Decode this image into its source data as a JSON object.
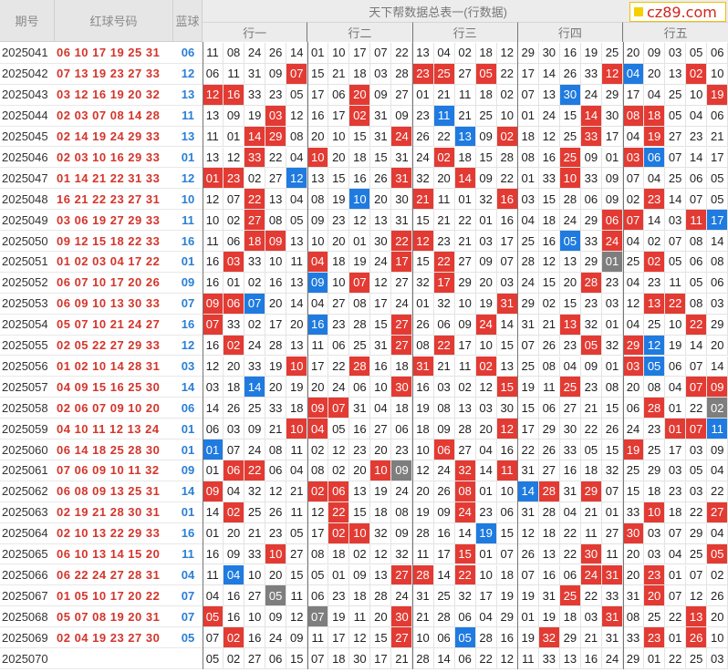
{
  "header": {
    "period_label": "期号",
    "red_label": "红球号码",
    "blue_label": "蓝球",
    "title": "天下帮数据总表一(行数据)",
    "group_labels": [
      "行一",
      "行二",
      "行三",
      "行四",
      "行五"
    ],
    "logo_text": "cz89.com"
  },
  "colors": {
    "red": "#e33b33",
    "blue": "#1f7be0",
    "gray": "#7e7e7e",
    "red_text": "#d4352b",
    "blue_text": "#2b7fd4"
  },
  "chart_data": {
    "type": "table",
    "title": "天下帮数据总表一(行数据)",
    "columns": [
      "期号",
      "红球号码",
      "蓝球",
      "行一",
      "行二",
      "行三",
      "行四",
      "行五"
    ],
    "cell_legend": {
      "r": "red",
      "b": "blue",
      "g": "gray"
    },
    "rows": [
      {
        "period": "2025041",
        "red": "06 10 17 19 25 31",
        "blue": "06",
        "cells": [
          "11",
          "08",
          "24",
          "26",
          "14",
          "01",
          "10",
          "17",
          "07",
          "22",
          "13",
          "04",
          "02",
          "18",
          "12",
          "29",
          "30",
          "16",
          "19",
          "25",
          "20",
          "09",
          "03",
          "05",
          "06"
        ],
        "marks": "..........................................................................r......................................................................rr........................................rr...........................g"
      },
      {
        "period": "2025042",
        "red": "07 13 19 23 27 33",
        "blue": "12",
        "cells": [
          "06",
          "11",
          "31",
          "09",
          "07",
          "15",
          "21",
          "18",
          "03",
          "28",
          "23",
          "25",
          "27",
          "05",
          "22",
          "17",
          "14",
          "26",
          "33",
          "12",
          "04",
          "20",
          "13",
          "02",
          "10"
        ],
        "marks": "....r.....rr.r.....rb..r.."
      },
      {
        "period": "2025043",
        "red": "03 12 16 19 20 32",
        "blue": "13",
        "cells": [
          "12",
          "16",
          "33",
          "23",
          "05",
          "17",
          "06",
          "20",
          "09",
          "27",
          "01",
          "21",
          "11",
          "18",
          "02",
          "07",
          "13",
          "30",
          "24",
          "29",
          "17",
          "04",
          "25",
          "10",
          "19"
        ],
        "marks": "rr.....r.........b......r"
      },
      {
        "period": "2025044",
        "red": "02 03 07 08 14 28",
        "blue": "11",
        "cells": [
          "13",
          "09",
          "19",
          "03",
          "12",
          "16",
          "17",
          "02",
          "31",
          "09",
          "23",
          "11",
          "21",
          "25",
          "10",
          "01",
          "24",
          "15",
          "14",
          "30",
          "08",
          "18",
          "05",
          "04",
          "06"
        ],
        "marks": "...r...r...b......r.rr...."
      },
      {
        "period": "2025045",
        "red": "02 14 19 24 29 33",
        "blue": "13",
        "cells": [
          "11",
          "01",
          "14",
          "29",
          "08",
          "20",
          "10",
          "15",
          "31",
          "24",
          "26",
          "22",
          "13",
          "09",
          "02",
          "18",
          "12",
          "25",
          "33",
          "17",
          "04",
          "19",
          "27",
          "23",
          "21"
        ],
        "marks": "..rr.....r..b.r...r..r..."
      },
      {
        "period": "2025046",
        "red": "02 03 10 16 29 33",
        "blue": "01",
        "cells": [
          "13",
          "12",
          "33",
          "22",
          "04",
          "10",
          "20",
          "18",
          "15",
          "31",
          "24",
          "02",
          "18",
          "15",
          "28",
          "08",
          "16",
          "25",
          "09",
          "01",
          "03",
          "06",
          "07",
          "14",
          "17"
        ],
        "marks": "..r..r.....r.....r..rb...."
      },
      {
        "period": "2025047",
        "red": "01 14 21 22 31 33",
        "blue": "12",
        "cells": [
          "01",
          "23",
          "02",
          "27",
          "12",
          "13",
          "15",
          "16",
          "26",
          "31",
          "32",
          "20",
          "14",
          "09",
          "22",
          "01",
          "33",
          "10",
          "33",
          "09",
          "07",
          "04",
          "25",
          "06",
          "05"
        ],
        "marks": "rr..b....r..r....r.......r"
      },
      {
        "period": "2025048",
        "red": "16 21 22 23 27 31",
        "blue": "10",
        "cells": [
          "12",
          "07",
          "22",
          "13",
          "04",
          "08",
          "19",
          "10",
          "20",
          "30",
          "21",
          "11",
          "01",
          "32",
          "16",
          "03",
          "15",
          "28",
          "06",
          "09",
          "02",
          "23",
          "14",
          "07",
          "05"
        ],
        "marks": "..r....b..r...r......r...."
      },
      {
        "period": "2025049",
        "red": "03 06 19 27 29 33",
        "blue": "11",
        "cells": [
          "10",
          "02",
          "27",
          "08",
          "05",
          "09",
          "23",
          "12",
          "13",
          "31",
          "15",
          "21",
          "22",
          "01",
          "16",
          "04",
          "18",
          "24",
          "29",
          "06",
          "07",
          "14",
          "03",
          "11",
          "17"
        ],
        "marks": "..r................rr..rb."
      },
      {
        "period": "2025050",
        "red": "09 12 15 18 22 33",
        "blue": "16",
        "cells": [
          "11",
          "06",
          "18",
          "09",
          "13",
          "10",
          "20",
          "01",
          "30",
          "22",
          "12",
          "23",
          "21",
          "03",
          "17",
          "25",
          "16",
          "05",
          "33",
          "24",
          "04",
          "02",
          "07",
          "08",
          "14"
        ],
        "marks": "..rr.....rr......b.r......"
      },
      {
        "period": "2025051",
        "red": "01 02 03 04 17 22",
        "blue": "01",
        "cells": [
          "16",
          "03",
          "33",
          "10",
          "11",
          "04",
          "18",
          "19",
          "24",
          "17",
          "15",
          "22",
          "27",
          "09",
          "07",
          "28",
          "12",
          "13",
          "29",
          "01",
          "25",
          "02",
          "05",
          "06",
          "08"
        ],
        "marks": ".r...r...r.r.......g.r...."
      },
      {
        "period": "2025052",
        "red": "06 07 10 17 20 26",
        "blue": "09",
        "cells": [
          "16",
          "01",
          "02",
          "16",
          "13",
          "09",
          "10",
          "07",
          "12",
          "27",
          "32",
          "17",
          "29",
          "20",
          "03",
          "24",
          "15",
          "20",
          "28",
          "23",
          "04",
          "23",
          "11",
          "05",
          "06"
        ],
        "marks": ".....b.r...r......r......r"
      },
      {
        "period": "2025053",
        "red": "06 09 10 13 30 33",
        "blue": "07",
        "cells": [
          "09",
          "06",
          "07",
          "20",
          "14",
          "04",
          "27",
          "08",
          "17",
          "24",
          "01",
          "32",
          "10",
          "19",
          "31",
          "29",
          "02",
          "15",
          "23",
          "03",
          "12",
          "13",
          "22",
          "08",
          "03"
        ],
        "marks": "rrb...........r......rr..."
      },
      {
        "period": "2025054",
        "red": "05 07 10 21 24 27",
        "blue": "16",
        "cells": [
          "07",
          "33",
          "02",
          "17",
          "20",
          "16",
          "23",
          "28",
          "15",
          "27",
          "26",
          "06",
          "09",
          "24",
          "14",
          "31",
          "21",
          "13",
          "32",
          "01",
          "04",
          "25",
          "10",
          "22",
          "29"
        ],
        "marks": "r....b...r...r...r.....r..."
      },
      {
        "period": "2025055",
        "red": "02 05 22 27 29 33",
        "blue": "12",
        "cells": [
          "16",
          "02",
          "24",
          "28",
          "13",
          "11",
          "06",
          "25",
          "31",
          "27",
          "08",
          "22",
          "17",
          "10",
          "15",
          "07",
          "26",
          "23",
          "05",
          "32",
          "29",
          "12",
          "19",
          "14",
          "20"
        ],
        "marks": ".r.......r.r......r.rb...."
      },
      {
        "period": "2025056",
        "red": "01 02 10 14 28 31",
        "blue": "03",
        "cells": [
          "12",
          "20",
          "33",
          "19",
          "10",
          "17",
          "22",
          "28",
          "16",
          "18",
          "31",
          "21",
          "11",
          "02",
          "13",
          "25",
          "08",
          "04",
          "09",
          "01",
          "03",
          "05",
          "06",
          "07",
          "14"
        ],
        "marks": "....r..r..r..r......rb....r"
      },
      {
        "period": "2025057",
        "red": "04 09 15 16 25 30",
        "blue": "14",
        "cells": [
          "03",
          "18",
          "14",
          "20",
          "19",
          "20",
          "24",
          "06",
          "10",
          "30",
          "16",
          "03",
          "02",
          "12",
          "15",
          "19",
          "11",
          "25",
          "23",
          "08",
          "20",
          "08",
          "04",
          "07",
          "09"
        ],
        "marks": "..b......r....r..r.....rr.r"
      },
      {
        "period": "2025058",
        "red": "02 06 07 09 10 20",
        "blue": "06",
        "cells": [
          "14",
          "26",
          "25",
          "33",
          "18",
          "09",
          "07",
          "31",
          "04",
          "18",
          "19",
          "08",
          "13",
          "03",
          "30",
          "15",
          "06",
          "27",
          "21",
          "15",
          "06",
          "28",
          "01",
          "22",
          "02"
        ],
        "marks": ".....rr..............r..g..r"
      },
      {
        "period": "2025059",
        "red": "04 10 11 12 13 24",
        "blue": "01",
        "cells": [
          "06",
          "03",
          "09",
          "21",
          "10",
          "04",
          "05",
          "16",
          "27",
          "06",
          "18",
          "09",
          "28",
          "20",
          "12",
          "17",
          "29",
          "30",
          "22",
          "26",
          "24",
          "23",
          "01",
          "07",
          "11"
        ],
        "marks": "....rr........r.......rrb.r"
      },
      {
        "period": "2025060",
        "red": "06 14 18 25 28 30",
        "blue": "01",
        "cells": [
          "01",
          "07",
          "24",
          "08",
          "11",
          "02",
          "12",
          "23",
          "20",
          "23",
          "10",
          "06",
          "27",
          "04",
          "16",
          "22",
          "26",
          "33",
          "05",
          "15",
          "19",
          "25",
          "17",
          "03",
          "09"
        ],
        "marks": "b..........r........r.....r"
      },
      {
        "period": "2025061",
        "red": "07 06 09 10 11 32",
        "blue": "09",
        "cells": [
          "01",
          "06",
          "22",
          "06",
          "04",
          "08",
          "02",
          "20",
          "10",
          "09",
          "12",
          "24",
          "32",
          "14",
          "11",
          "31",
          "27",
          "16",
          "18",
          "32",
          "25",
          "29",
          "03",
          "05",
          "04"
        ],
        "marks": ".rr.....rg..r.r..............."
      },
      {
        "period": "2025062",
        "red": "06 08 09 13 25 31",
        "blue": "14",
        "cells": [
          "09",
          "04",
          "32",
          "12",
          "21",
          "02",
          "06",
          "13",
          "19",
          "24",
          "20",
          "26",
          "08",
          "01",
          "10",
          "14",
          "28",
          "31",
          "29",
          "07",
          "15",
          "18",
          "23",
          "03",
          "22"
        ],
        "marks": "r....rr.....r..br.r........."
      },
      {
        "period": "2025063",
        "red": "02 19 21 28 30 31",
        "blue": "01",
        "cells": [
          "14",
          "02",
          "25",
          "26",
          "11",
          "12",
          "22",
          "15",
          "18",
          "08",
          "19",
          "09",
          "24",
          "23",
          "06",
          "31",
          "28",
          "04",
          "21",
          "01",
          "33",
          "10",
          "18",
          "22",
          "27"
        ],
        "marks": ".r....r.....r........r..rb......"
      },
      {
        "period": "2025064",
        "red": "02 10 13 22 29 33",
        "blue": "16",
        "cells": [
          "01",
          "20",
          "21",
          "23",
          "05",
          "17",
          "02",
          "10",
          "32",
          "09",
          "28",
          "16",
          "14",
          "19",
          "15",
          "12",
          "18",
          "22",
          "11",
          "27",
          "30",
          "03",
          "07",
          "29",
          "04"
        ],
        "marks": "......rr.....b......r....r."
      },
      {
        "period": "2025065",
        "red": "06 10 13 14 15 20",
        "blue": "11",
        "cells": [
          "16",
          "09",
          "33",
          "10",
          "27",
          "08",
          "18",
          "02",
          "12",
          "32",
          "11",
          "17",
          "15",
          "01",
          "07",
          "26",
          "13",
          "22",
          "30",
          "11",
          "20",
          "03",
          "04",
          "25",
          "05"
        ],
        "marks": "...r........r.....r.....r..."
      },
      {
        "period": "2025066",
        "red": "06 22 24 27 28 31",
        "blue": "04",
        "cells": [
          "11",
          "04",
          "10",
          "20",
          "15",
          "05",
          "01",
          "09",
          "13",
          "27",
          "28",
          "14",
          "22",
          "10",
          "18",
          "07",
          "16",
          "06",
          "24",
          "31",
          "20",
          "23",
          "01",
          "07",
          "02"
        ],
        "marks": ".b.......rr.r.....rr.r......"
      },
      {
        "period": "2025067",
        "red": "01 05 10 17 20 22",
        "blue": "07",
        "cells": [
          "04",
          "16",
          "27",
          "05",
          "11",
          "06",
          "23",
          "18",
          "28",
          "24",
          "31",
          "25",
          "32",
          "17",
          "19",
          "19",
          "31",
          "25",
          "22",
          "33",
          "31",
          "20",
          "07",
          "12",
          "26"
        ],
        "marks": "...g.............r...r...r...."
      },
      {
        "period": "2025068",
        "red": "05 07 08 19 20 31",
        "blue": "07",
        "cells": [
          "05",
          "16",
          "10",
          "09",
          "12",
          "07",
          "19",
          "11",
          "20",
          "30",
          "21",
          "28",
          "06",
          "04",
          "29",
          "01",
          "19",
          "18",
          "03",
          "31",
          "08",
          "25",
          "22",
          "13",
          "20"
        ],
        "marks": "r....g...r.........r...r..r."
      },
      {
        "period": "2025069",
        "red": "02 04 19 23 27 30",
        "blue": "05",
        "cells": [
          "07",
          "02",
          "16",
          "24",
          "09",
          "11",
          "17",
          "12",
          "15",
          "27",
          "10",
          "06",
          "05",
          "28",
          "16",
          "19",
          "32",
          "29",
          "21",
          "31",
          "33",
          "23",
          "01",
          "26",
          "10"
        ],
        "marks": ".r.......r..b...r....r.r....."
      },
      {
        "period": "2025070",
        "red": "",
        "blue": "",
        "cells": [
          "05",
          "02",
          "27",
          "06",
          "15",
          "07",
          "18",
          "30",
          "17",
          "21",
          "28",
          "14",
          "06",
          "22",
          "12",
          "11",
          "33",
          "13",
          "16",
          "24",
          "29",
          "01",
          "22",
          "25",
          "03"
        ],
        "marks": "..........................."
      }
    ]
  }
}
